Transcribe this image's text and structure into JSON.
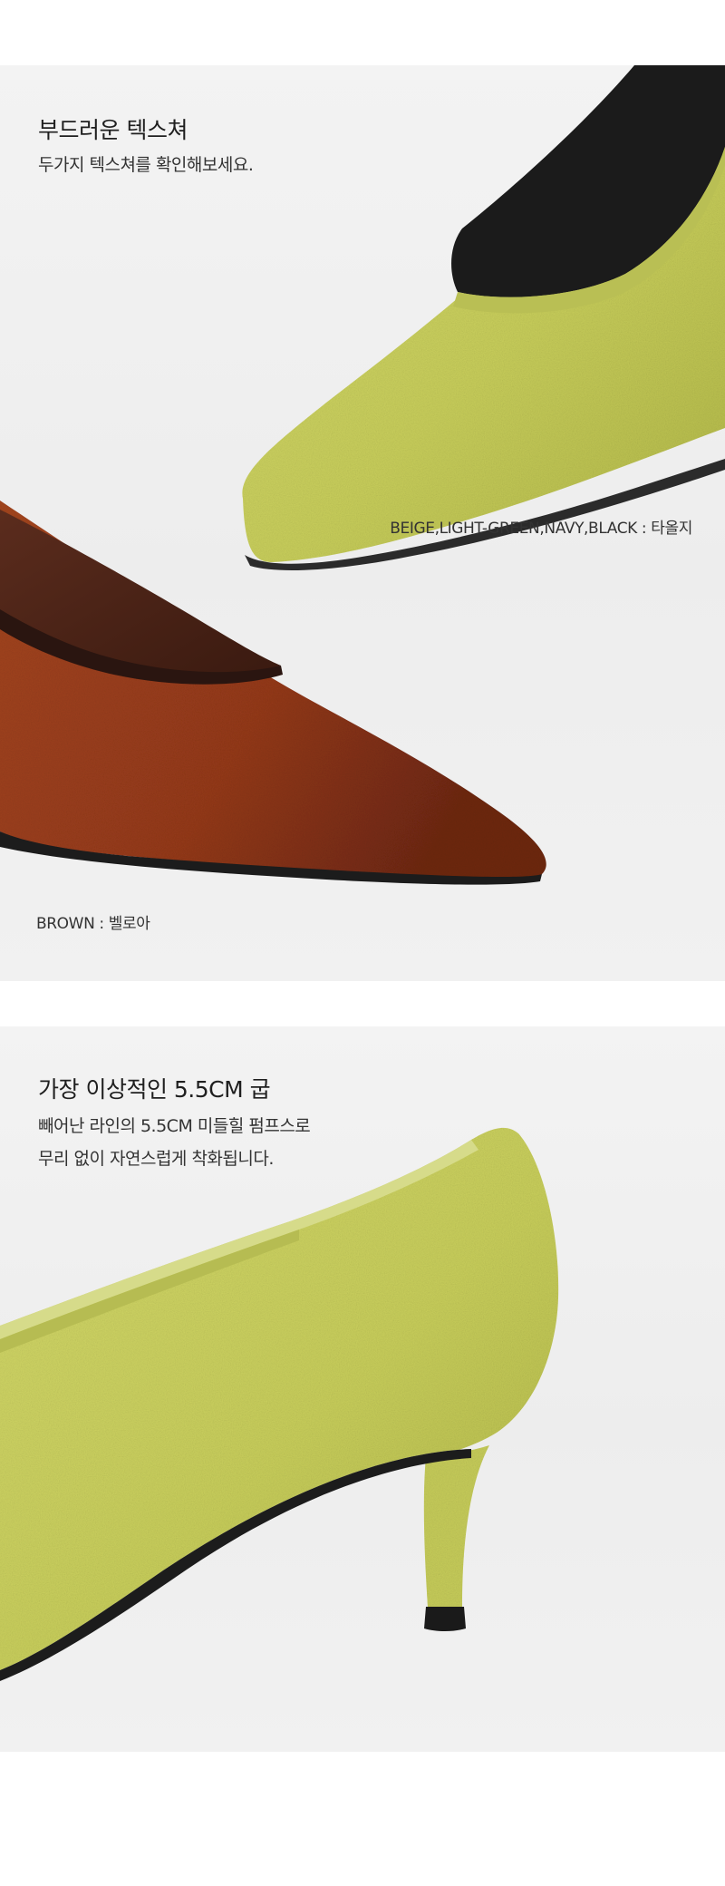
{
  "section_texture": {
    "title": "부드러운 텍스쳐",
    "description": "두가지 텍스쳐를 확인해보세요.",
    "caption_green": "BEIGE,LIGHT-GREEN,NAVY,BLACK : 타올지",
    "caption_brown": "BROWN : 벨로아"
  },
  "section_heel": {
    "title": "가장 이상적인 5.5CM 굽",
    "description_lines": [
      "빼어난 라인의 5.5CM 미들힐 펌프스로",
      "무리 없이 자연스럽게 착화됩니다."
    ]
  },
  "colors": {
    "lime_shoe": "#c9cf5c",
    "brown_shoe": "#9a3f1c",
    "background": "#efefef",
    "sole": "#1c1c1c"
  }
}
